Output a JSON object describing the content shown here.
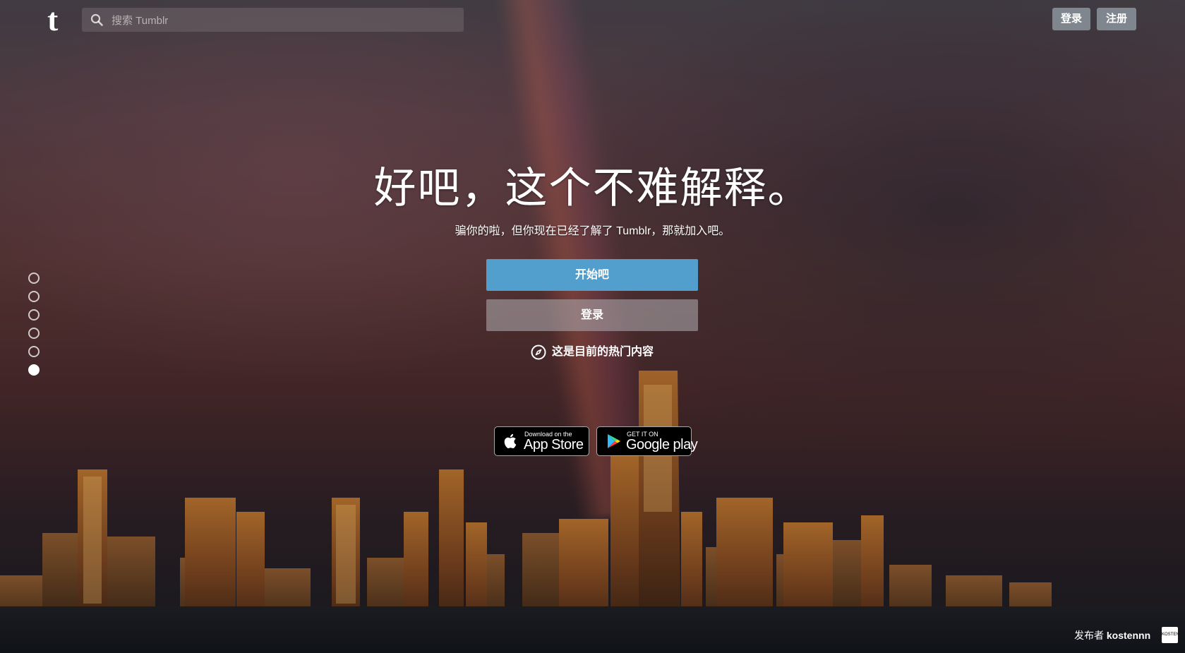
{
  "header": {
    "logo": "t",
    "search_placeholder": "搜索 Tumblr",
    "login_label": "登录",
    "signup_label": "注册"
  },
  "hero": {
    "title": "好吧，这个不难解释。",
    "subtitle": "骗你的啦，但你现在已经了解了 Tumblr，那就加入吧。",
    "start_label": "开始吧",
    "login_label": "登录",
    "trending_label": "这是目前的热门内容"
  },
  "badges": {
    "apple": {
      "small": "Download on the",
      "big": "App Store",
      "icon": "apple-icon"
    },
    "google": {
      "small": "GET IT ON",
      "big": "Google play",
      "icon": "google-play-icon"
    }
  },
  "pager": {
    "count": 6,
    "active_index": 5
  },
  "credit": {
    "prefix": "发布者",
    "author": "kostennn",
    "avatar_text": "KOSTEN"
  },
  "colors": {
    "primary_button": "#529ecc",
    "secondary_button": "#aaa5aa"
  }
}
